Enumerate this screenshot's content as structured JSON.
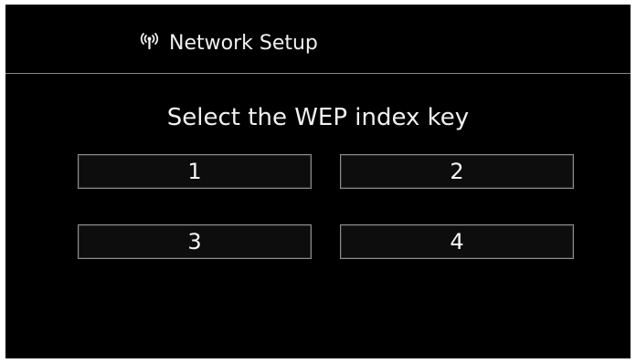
{
  "header": {
    "icon": "wireless-signal-icon",
    "title": "Network Setup"
  },
  "prompt": "Select the WEP index key",
  "keys": [
    {
      "label": "1"
    },
    {
      "label": "2"
    },
    {
      "label": "3"
    },
    {
      "label": "4"
    }
  ],
  "colors": {
    "background": "#000000",
    "text": "#f0f0f0",
    "button_border": "#8d8d8d",
    "divider": "#8a8a8a"
  }
}
